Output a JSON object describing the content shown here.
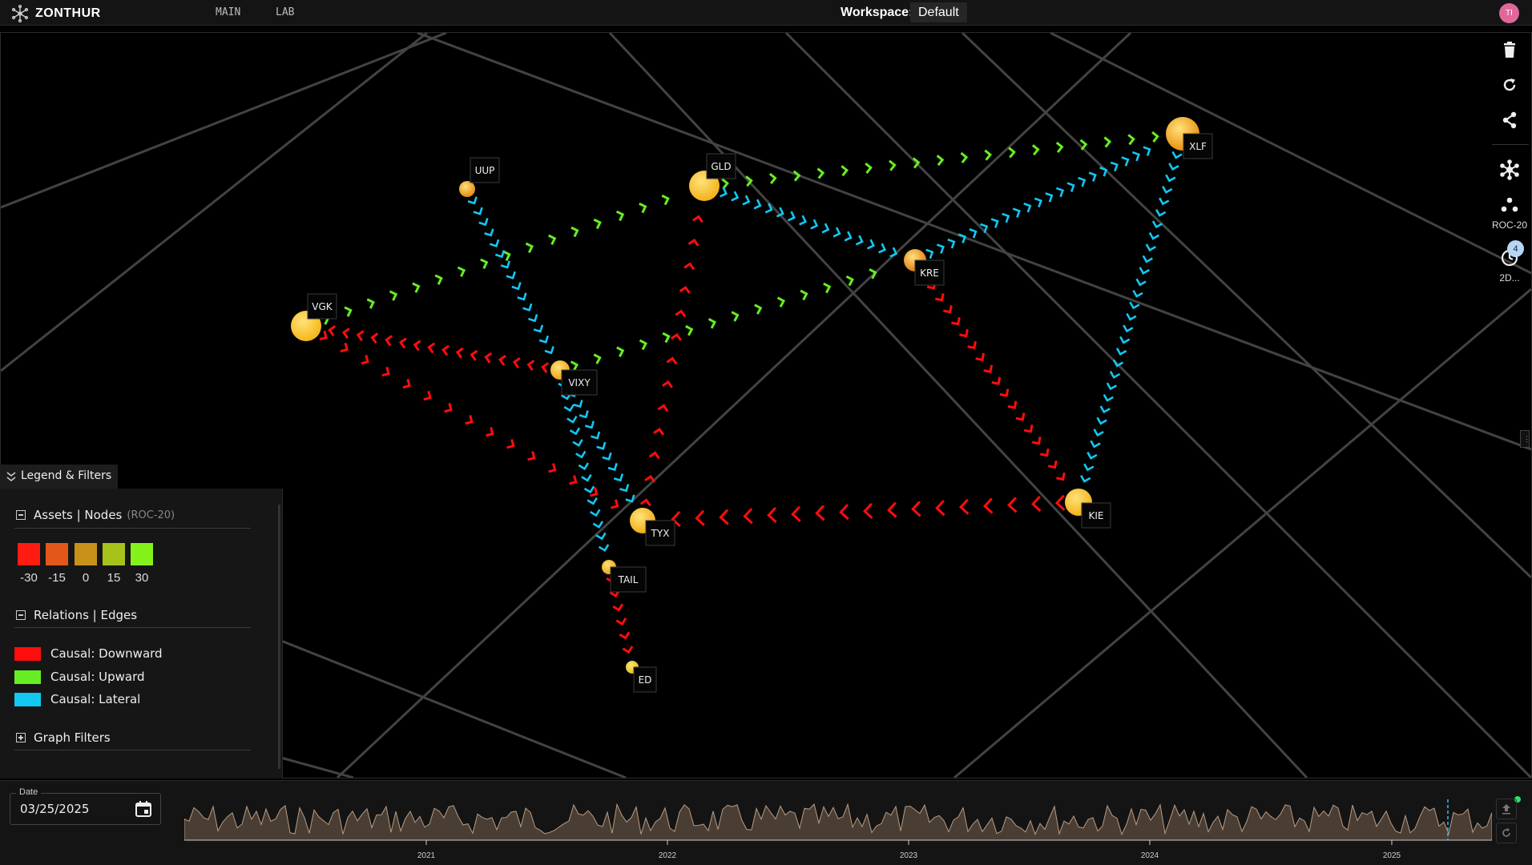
{
  "app": {
    "brand": "ZONTHUR",
    "nav": [
      "MAIN",
      "LAB"
    ],
    "workspace_label": "Workspace:",
    "workspace_value": "Default",
    "avatar_initials": "TI"
  },
  "right_toolbar": {
    "icons": [
      "trash-icon",
      "refresh-icon",
      "share-icon",
      "network-layout-icon",
      "cluster-icon",
      "history-icon"
    ],
    "cluster_caption": "ROC-20",
    "history_caption": "2D...",
    "history_badge": "4"
  },
  "graph": {
    "nodes": [
      {
        "label": "UUP",
        "color": "#e38a12"
      },
      {
        "label": "GLD",
        "color": "#f2b21a"
      },
      {
        "label": "XLF",
        "color": "#e8900f"
      },
      {
        "label": "KRE",
        "color": "#e07b12"
      },
      {
        "label": "VGK",
        "color": "#f5b818"
      },
      {
        "label": "VIXY",
        "color": "#eda316"
      },
      {
        "label": "TYX",
        "color": "#f0ad17"
      },
      {
        "label": "KIE",
        "color": "#f2b21a"
      },
      {
        "label": "TAIL",
        "color": "#eaa414"
      },
      {
        "label": "ED",
        "color": "#dcc318"
      }
    ],
    "edges": [
      {
        "from": "VGK",
        "to": "GLD",
        "kind": "up"
      },
      {
        "from": "GLD",
        "to": "XLF",
        "kind": "up"
      },
      {
        "from": "VIXY",
        "to": "KRE",
        "kind": "up"
      },
      {
        "from": "VIXY",
        "to": "VGK",
        "kind": "down"
      },
      {
        "from": "VGK",
        "to": "TYX",
        "kind": "down"
      },
      {
        "from": "TYX",
        "to": "GLD",
        "kind": "down"
      },
      {
        "from": "KRE",
        "to": "KIE",
        "kind": "down"
      },
      {
        "from": "KIE",
        "to": "TYX",
        "kind": "down"
      },
      {
        "from": "TAIL",
        "to": "ED",
        "kind": "down"
      },
      {
        "from": "UUP",
        "to": "VIXY",
        "kind": "lateral"
      },
      {
        "from": "GLD",
        "to": "KRE",
        "kind": "lateral"
      },
      {
        "from": "KRE",
        "to": "XLF",
        "kind": "lateral"
      },
      {
        "from": "XLF",
        "to": "KIE",
        "kind": "lateral"
      },
      {
        "from": "VIXY",
        "to": "TYX",
        "kind": "lateral"
      },
      {
        "from": "VIXY",
        "to": "TAIL",
        "kind": "lateral"
      }
    ]
  },
  "legend": {
    "tab_label": "Legend & Filters",
    "assets_title": "Assets | Nodes",
    "assets_sub": "(ROC-20)",
    "scale": [
      {
        "value": "-30",
        "color": "#ff1a12"
      },
      {
        "value": "-15",
        "color": "#e4571a"
      },
      {
        "value": "0",
        "color": "#c8921a"
      },
      {
        "value": "15",
        "color": "#a7c21a"
      },
      {
        "value": "30",
        "color": "#84f21a"
      }
    ],
    "relations_title": "Relations | Edges",
    "edge_types": [
      {
        "label": "Causal: Downward",
        "color": "#ff0d0d"
      },
      {
        "label": "Causal: Upward",
        "color": "#66ee22"
      },
      {
        "label": "Causal: Lateral",
        "color": "#12c8f2"
      }
    ],
    "filters_title": "Graph Filters"
  },
  "date_picker": {
    "label": "Date",
    "value": "03/25/2025"
  },
  "timeline": {
    "years": [
      "2021",
      "2022",
      "2023",
      "2024",
      "2025"
    ],
    "marker_date": "03/25/2025"
  }
}
